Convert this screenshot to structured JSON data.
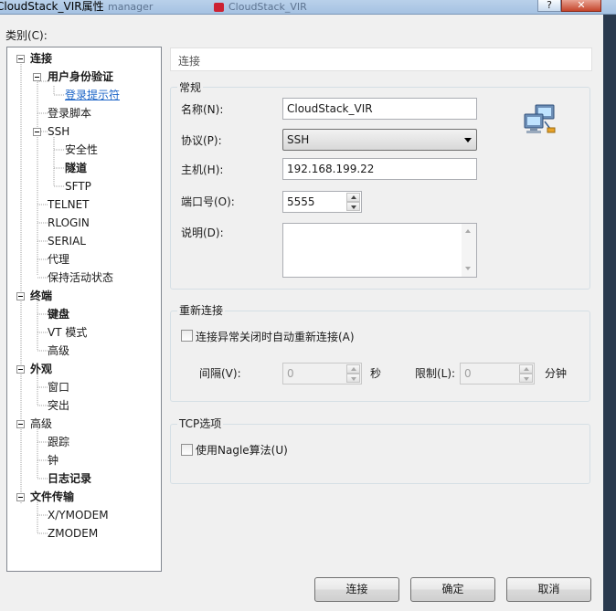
{
  "window": {
    "title": "CloudStack_VIR属性",
    "bg_tab_1": "manager",
    "bg_tab_2": "CloudStack_VIR",
    "help_glyph": "?",
    "close_glyph": "✕"
  },
  "category_label": "类别(C):",
  "tree": [
    {
      "label": "连接",
      "bold": true
    },
    {
      "label": "用户身份验证",
      "bold": true
    },
    {
      "label": "登录提示符",
      "link": true
    },
    {
      "label": "登录脚本"
    },
    {
      "label": "SSH"
    },
    {
      "label": "安全性"
    },
    {
      "label": "隧道",
      "bold": true
    },
    {
      "label": "SFTP"
    },
    {
      "label": "TELNET"
    },
    {
      "label": "RLOGIN"
    },
    {
      "label": "SERIAL"
    },
    {
      "label": "代理"
    },
    {
      "label": "保持活动状态"
    },
    {
      "label": "终端",
      "bold": true
    },
    {
      "label": "键盘",
      "bold": true
    },
    {
      "label": "VT 模式"
    },
    {
      "label": "高级"
    },
    {
      "label": "外观",
      "bold": true
    },
    {
      "label": "窗口"
    },
    {
      "label": "突出"
    },
    {
      "label": "高级"
    },
    {
      "label": "跟踪"
    },
    {
      "label": "钟"
    },
    {
      "label": "日志记录",
      "bold": true
    },
    {
      "label": "文件传输",
      "bold": true
    },
    {
      "label": "X/YMODEM"
    },
    {
      "label": "ZMODEM"
    }
  ],
  "panel_header": "连接",
  "general": {
    "title": "常规",
    "name_label": "名称(N):",
    "name_value": "CloudStack_VIR",
    "protocol_label": "协议(P):",
    "protocol_value": "SSH",
    "host_label": "主机(H):",
    "host_value": "192.168.199.22",
    "port_label": "端口号(O):",
    "port_value": "5555",
    "desc_label": "说明(D):",
    "desc_value": ""
  },
  "reconnect": {
    "title": "重新连接",
    "auto_label": "连接异常关闭时自动重新连接(A)",
    "auto_checked": false,
    "interval_label": "间隔(V):",
    "interval_value": "0",
    "interval_unit": "秒",
    "limit_label": "限制(L):",
    "limit_value": "0",
    "limit_unit": "分钟"
  },
  "tcp": {
    "title": "TCP选项",
    "nagle_label": "使用Nagle算法(U)",
    "nagle_checked": false
  },
  "buttons": {
    "connect": "连接",
    "ok": "确定",
    "cancel": "取消"
  },
  "icons": {
    "network": "network-computers-icon"
  },
  "colors": {
    "link": "#1a63c7",
    "titlebar": "#b9d1ea"
  }
}
